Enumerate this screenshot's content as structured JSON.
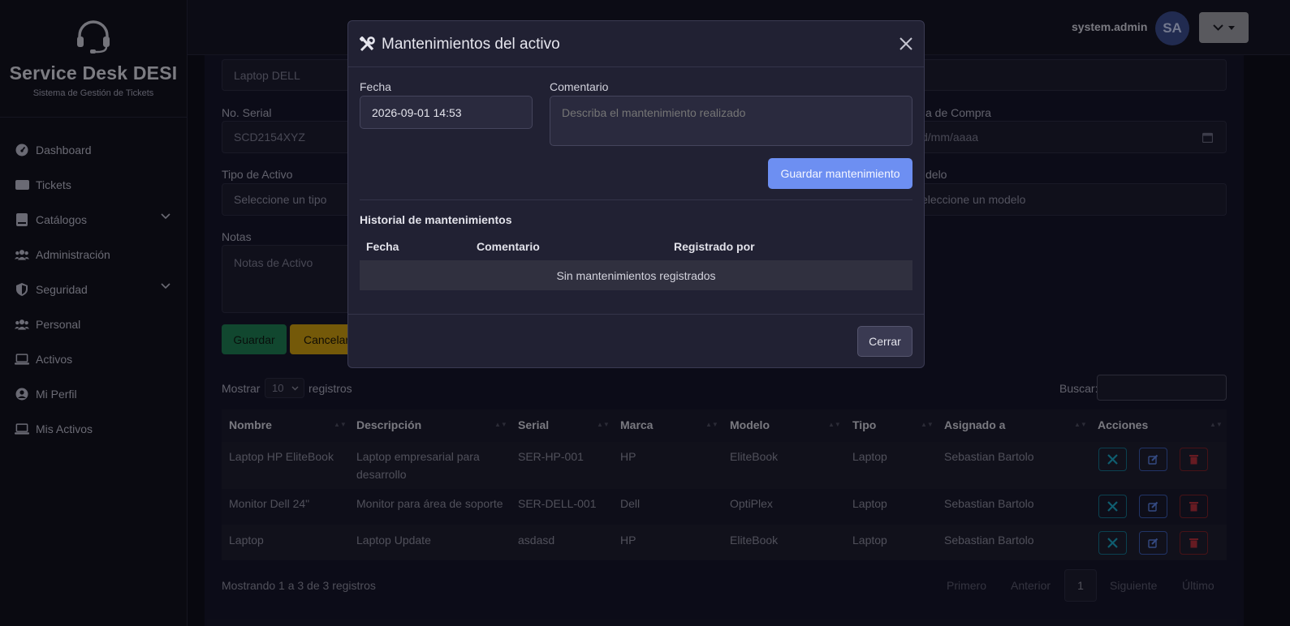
{
  "brand": {
    "title": "Service Desk DESI",
    "subtitle": "Sistema de Gestión de Tickets",
    "icon": "headset-icon"
  },
  "sidebar": {
    "items": [
      {
        "label": "Dashboard",
        "icon": "gauge-icon"
      },
      {
        "label": "Tickets",
        "icon": "ticket-icon"
      },
      {
        "label": "Catálogos",
        "icon": "book-icon",
        "expandable": true
      },
      {
        "label": "Administración",
        "icon": "users-icon"
      },
      {
        "label": "Seguridad",
        "icon": "shield-icon",
        "expandable": true
      },
      {
        "label": "Personal",
        "icon": "users-icon"
      },
      {
        "label": "Activos",
        "icon": "laptop-icon"
      },
      {
        "label": "Mi Perfil",
        "icon": "user-circle-icon"
      },
      {
        "label": "Mis Activos",
        "icon": "laptop-icon"
      }
    ]
  },
  "topbar": {
    "username": "system.admin",
    "avatar_initials": "SA"
  },
  "form": {
    "name_value": "Laptop DELL",
    "serial_label": "No. Serial",
    "serial_value": "SCD2154XYZ",
    "purchase_label": "a de Compra",
    "purchase_placeholder": "d/mm/aaaa",
    "type_label": "Tipo de Activo",
    "type_value": "Seleccione un tipo",
    "model_label": "delo",
    "model_value": "eleccione un modelo",
    "notes_label": "Notas",
    "notes_placeholder": "Notas de Activo",
    "save_label": "Guardar",
    "cancel_label": "Cancelar"
  },
  "table": {
    "show_label": "Mostrar",
    "page_size": "10",
    "records_label": "registros",
    "search_label": "Buscar:",
    "columns": [
      "Nombre",
      "Descripción",
      "Serial",
      "Marca",
      "Modelo",
      "Tipo",
      "Asignado a",
      "Acciones"
    ],
    "rows": [
      {
        "nombre": "Laptop HP EliteBook",
        "descripcion": "Laptop empresarial para desarrollo",
        "serial": "SER-HP-001",
        "marca": "HP",
        "modelo": "EliteBook",
        "tipo": "Laptop",
        "asignado": "Sebastian Bartolo"
      },
      {
        "nombre": "Monitor Dell 24\"",
        "descripcion": "Monitor para área de soporte",
        "serial": "SER-DELL-001",
        "marca": "Dell",
        "modelo": "OptiPlex",
        "tipo": "Laptop",
        "asignado": "Sebastian Bartolo"
      },
      {
        "nombre": "Laptop",
        "descripcion": "Laptop Update",
        "serial": "asdasd",
        "marca": "HP",
        "modelo": "EliteBook",
        "tipo": "Laptop",
        "asignado": "Sebastian Bartolo"
      }
    ],
    "info": "Mostrando 1 a 3 de 3 registros",
    "pagination": {
      "first": "Primero",
      "prev": "Anterior",
      "page": "1",
      "next": "Siguiente",
      "last": "Último"
    }
  },
  "modal": {
    "title": "Mantenimientos del activo",
    "date_label": "Fecha",
    "date_value": "2026-09-01 14:53",
    "comment_label": "Comentario",
    "comment_placeholder": "Describa el mantenimiento realizado",
    "save_label": "Guardar mantenimiento",
    "history_title": "Historial de mantenimientos",
    "history_columns": [
      "Fecha",
      "Comentario",
      "Registrado por"
    ],
    "empty_text": "Sin mantenimientos registrados",
    "close_label": "Cerrar"
  },
  "colors": {
    "primary": "#6d8ff2",
    "success": "#1e7a52",
    "warning": "#c99a10",
    "danger": "#dc3545",
    "info": "#1aa0c0"
  }
}
